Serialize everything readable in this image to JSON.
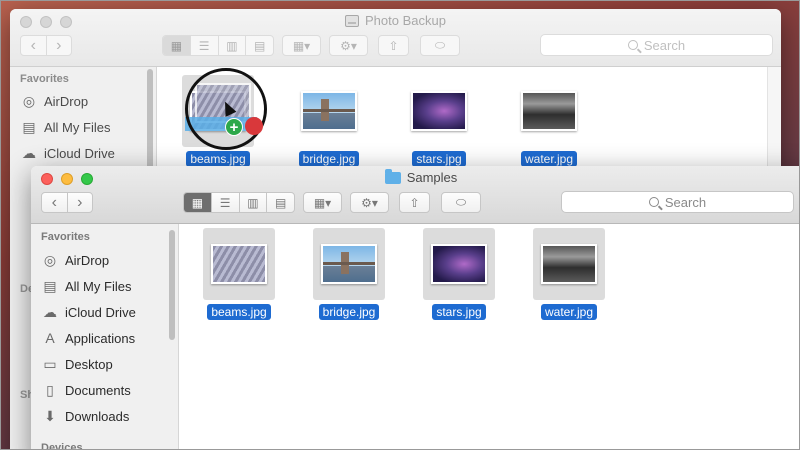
{
  "back_window": {
    "title": "Photo Backup",
    "search_placeholder": "Search",
    "sidebar": {
      "favorites_label": "Favorites",
      "items": [
        {
          "label": "AirDrop",
          "icon": "airdrop-icon"
        },
        {
          "label": "All My Files",
          "icon": "all-files-icon"
        },
        {
          "label": "iCloud Drive",
          "icon": "cloud-icon"
        }
      ],
      "fragment_labels": [
        "De",
        "Sh"
      ]
    },
    "files": [
      {
        "name": "beams.jpg",
        "image": "beams"
      },
      {
        "name": "bridge.jpg",
        "image": "bridge"
      },
      {
        "name": "stars.jpg",
        "image": "stars"
      },
      {
        "name": "water.jpg",
        "image": "water"
      }
    ]
  },
  "front_window": {
    "title": "Samples",
    "search_placeholder": "Search",
    "sidebar": {
      "favorites_label": "Favorites",
      "items": [
        {
          "label": "AirDrop",
          "icon": "airdrop-icon"
        },
        {
          "label": "All My Files",
          "icon": "all-files-icon"
        },
        {
          "label": "iCloud Drive",
          "icon": "cloud-icon"
        },
        {
          "label": "Applications",
          "icon": "applications-icon"
        },
        {
          "label": "Desktop",
          "icon": "desktop-icon"
        },
        {
          "label": "Documents",
          "icon": "documents-icon"
        },
        {
          "label": "Downloads",
          "icon": "downloads-icon"
        }
      ],
      "devices_label": "Devices"
    },
    "files": [
      {
        "name": "beams.jpg",
        "image": "beams"
      },
      {
        "name": "bridge.jpg",
        "image": "bridge"
      },
      {
        "name": "stars.jpg",
        "image": "stars"
      },
      {
        "name": "water.jpg",
        "image": "water"
      }
    ]
  },
  "toolbar_icons": [
    "back-icon",
    "forward-icon",
    "icon-view-icon",
    "list-view-icon",
    "column-view-icon",
    "cover-flow-icon",
    "arrange-icon",
    "action-gear-icon",
    "share-icon",
    "tag-icon"
  ],
  "drag": {
    "file": "beams.jpg",
    "badge": "+"
  },
  "colors": {
    "selection": "#1e6bd1",
    "close": "#fc605c",
    "minimize": "#fdbc40",
    "zoom": "#34c84a",
    "copy_badge": "#2da84a"
  }
}
